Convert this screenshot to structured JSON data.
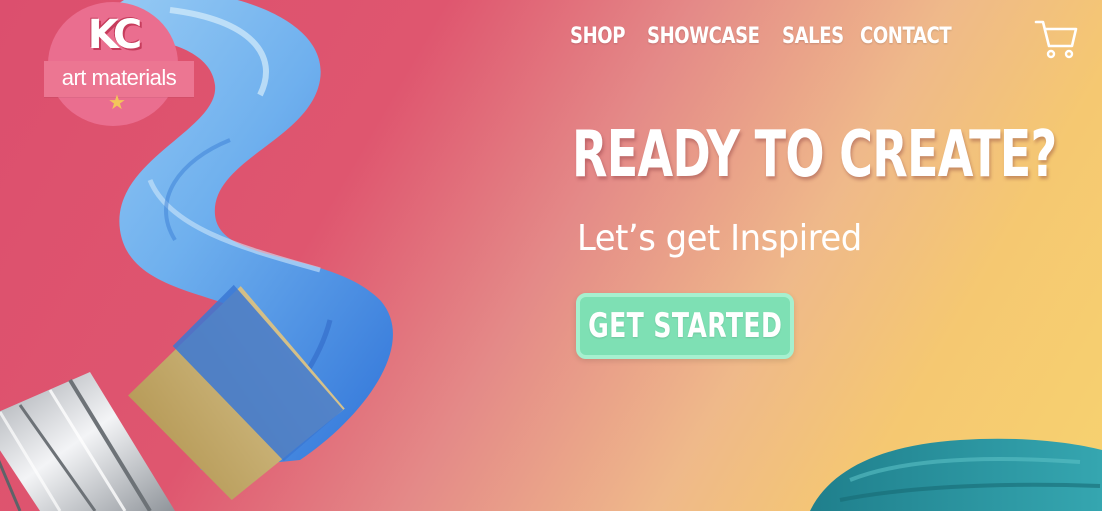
{
  "brand": {
    "monogram": "KC",
    "tagline": "art materials",
    "star": "★"
  },
  "nav": {
    "items": [
      {
        "label": "SHOP"
      },
      {
        "label": "SHOWCASE"
      },
      {
        "label": "SALES"
      },
      {
        "label": "CONTACT"
      }
    ],
    "cart_icon": "shopping-cart-icon"
  },
  "hero": {
    "headline": "READY TO CREATE?",
    "subheadline": "Let’s get Inspired",
    "cta_label": "GET STARTED"
  },
  "colors": {
    "gradient_start": "#dc4f6e",
    "gradient_end": "#f7d270",
    "paint_blue": "#4a90e0",
    "paint_teal": "#2a8f9a",
    "cta_green": "#7ee0b4",
    "logo_pink": "#ea6e8f",
    "star_yellow": "#f3c65a"
  }
}
